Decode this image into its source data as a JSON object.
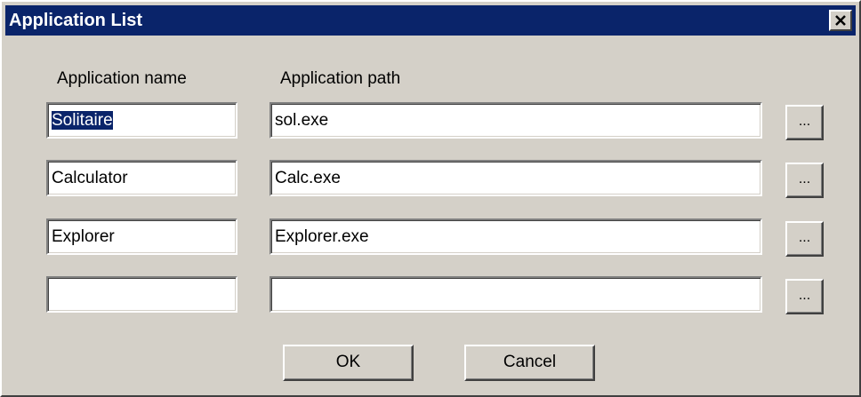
{
  "window": {
    "title": "Application List"
  },
  "columns": {
    "name_header": "Application name",
    "path_header": "Application path"
  },
  "rows": [
    {
      "name": "Solitaire",
      "name_selected": true,
      "path": "sol.exe",
      "browse_label": "..."
    },
    {
      "name": "Calculator",
      "name_selected": false,
      "path": "Calc.exe",
      "browse_label": "..."
    },
    {
      "name": "Explorer",
      "name_selected": false,
      "path": "Explorer.exe",
      "browse_label": "..."
    },
    {
      "name": "",
      "name_selected": false,
      "path": "",
      "browse_label": "..."
    }
  ],
  "buttons": {
    "ok_label": "OK",
    "cancel_label": "Cancel"
  },
  "icons": {
    "close": "close-icon"
  },
  "colors": {
    "titlebar": "#0a246a",
    "dialog_face": "#d4d0c8",
    "selection": "#0a246a"
  }
}
